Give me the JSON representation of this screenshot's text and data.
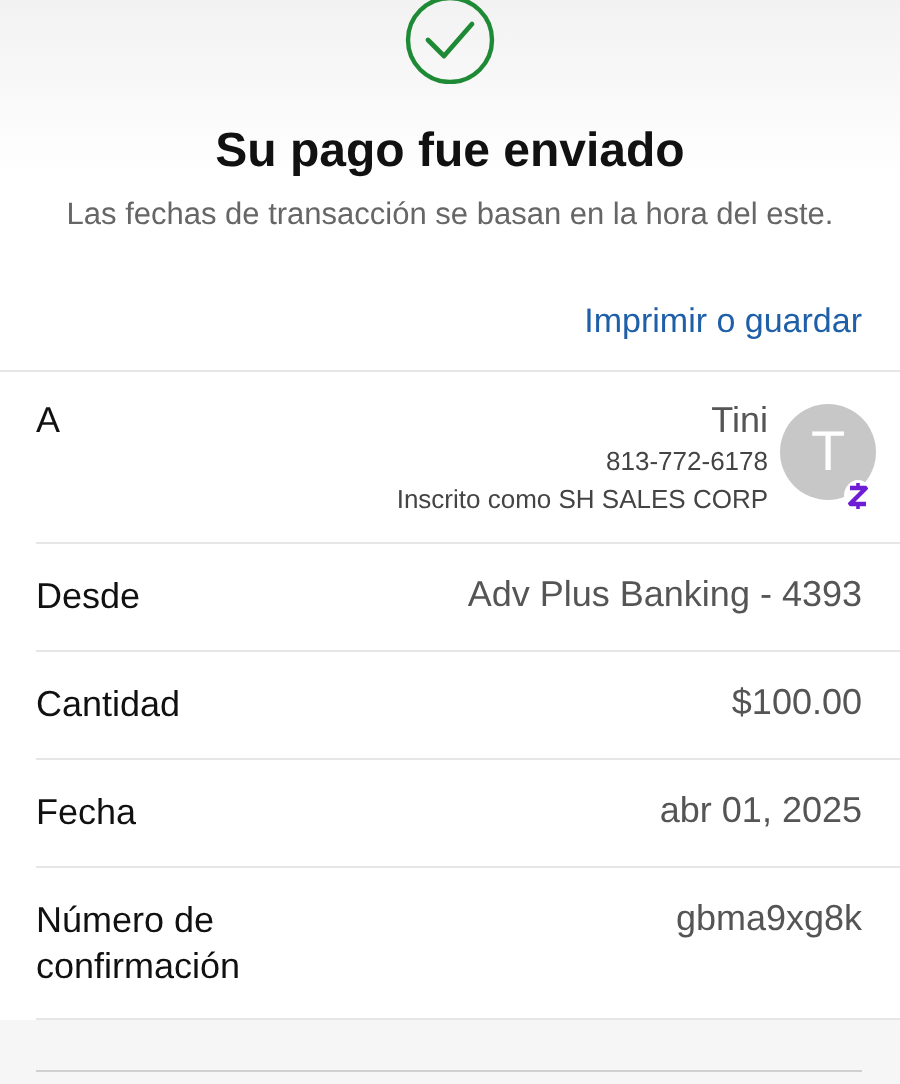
{
  "header": {
    "title": "Su pago fue enviado",
    "subtitle": "Las fechas de transacción se basan en la hora del este."
  },
  "print_link": "Imprimir o guardar",
  "recipient": {
    "label": "A",
    "name": "Tini",
    "phone": "813-772-6178",
    "enrolled_as": "Inscrito como SH SALES CORP",
    "avatar_initial": "T"
  },
  "details": [
    {
      "label": "Desde",
      "value": "Adv Plus Banking - 4393"
    },
    {
      "label": "Cantidad",
      "value": "$100.00"
    },
    {
      "label": "Fecha",
      "value": "abr 01, 2025"
    },
    {
      "label": "Número de confirmación",
      "value": "gbma9xg8k"
    }
  ]
}
